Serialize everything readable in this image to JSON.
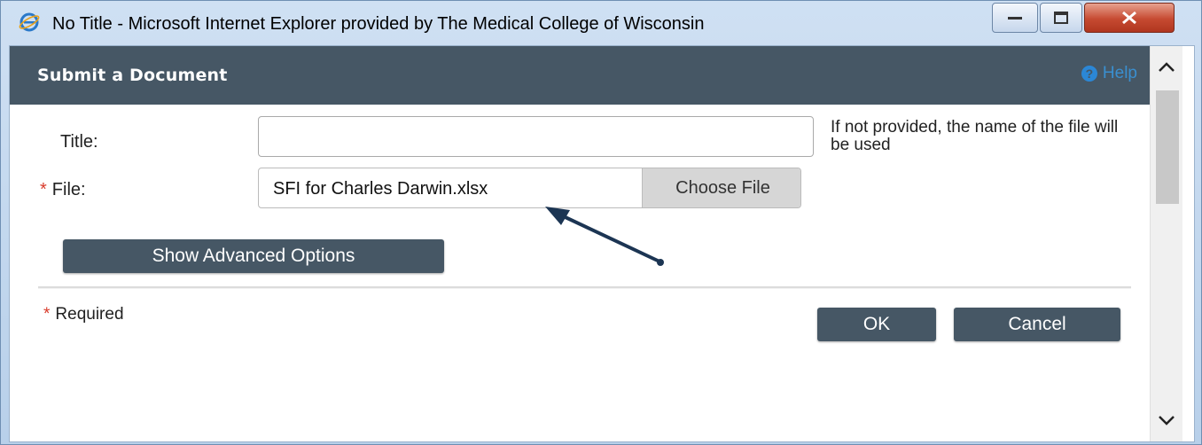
{
  "window": {
    "title": "No Title - Microsoft Internet Explorer provided by The Medical College of Wisconsin"
  },
  "dialog": {
    "title": "Submit a Document",
    "help_label": "Help"
  },
  "form": {
    "title_label": "Title:",
    "title_value": "",
    "title_hint": "If not provided, the name of the file will be used",
    "file_required_mark": "*",
    "file_label": "File:",
    "file_value": "SFI for Charles Darwin.xlsx",
    "choose_file_label": "Choose File",
    "advanced_options_label": "Show Advanced Options"
  },
  "footer": {
    "required_mark": "*",
    "required_label": "Required",
    "ok_label": "OK",
    "cancel_label": "Cancel"
  },
  "colors": {
    "header_bg": "#465765",
    "required": "#d93a2a",
    "help_link": "#3a8fd0",
    "annotation_arrow": "#1c3553"
  },
  "icons": [
    "ie-icon",
    "minimize-icon",
    "maximize-icon",
    "close-icon",
    "help-circle-icon",
    "chevron-up-icon",
    "chevron-down-icon",
    "annotation-arrow"
  ]
}
